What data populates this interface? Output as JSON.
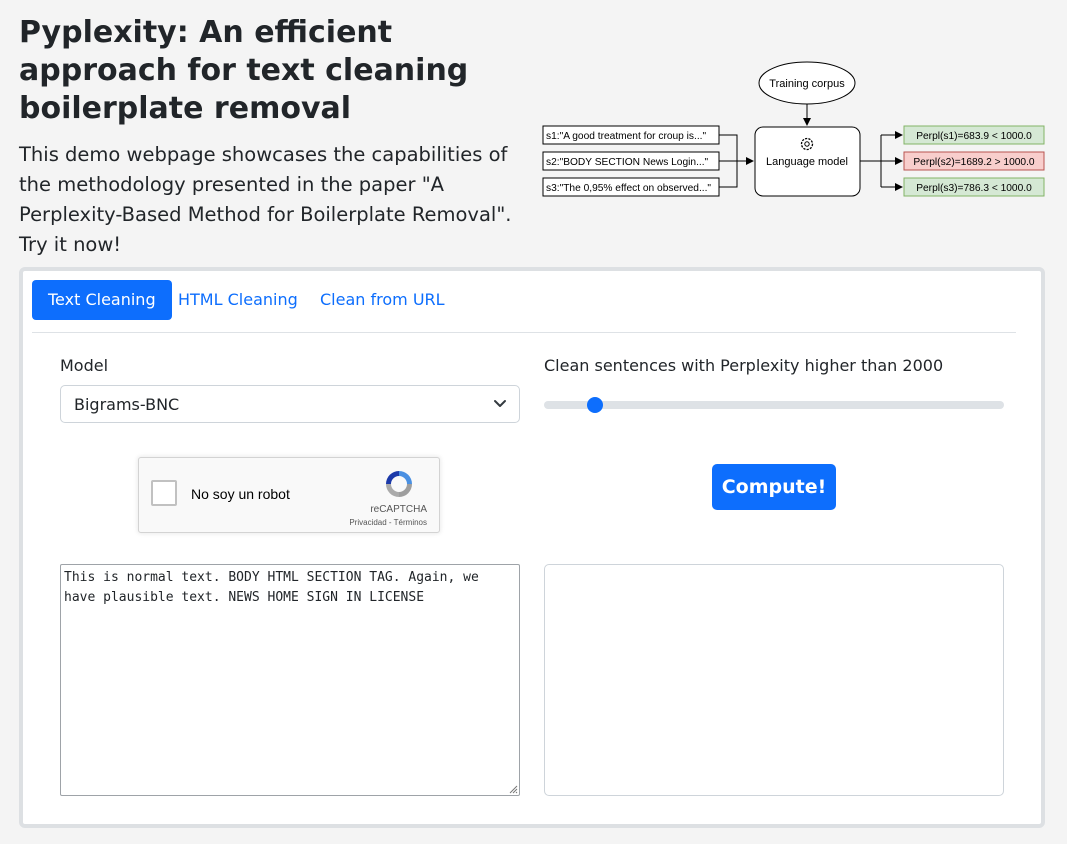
{
  "header": {
    "title": "Pyplexity: An efficient approach for text cleaning boilerplate removal",
    "description": "This demo webpage showcases the capabilities of the methodology presented in the paper \"A Perplexity-Based Method for Boilerplate Removal\". Try it now!"
  },
  "diagram": {
    "training_corpus": "Training corpus",
    "language_model": "Language model",
    "model_icon": "gear-icon",
    "inputs": [
      "s1:\"A good treatment for croup is...\"",
      "s2:\"BODY SECTION News Login...\"",
      "s3:\"The 0,95% effect on observed...\""
    ],
    "outputs": [
      "Perpl(s1)=683.9 < 1000.0",
      "Perpl(s2)=1689.2 > 1000.0",
      "Perpl(s3)=786.3 < 1000.0"
    ],
    "output_colors": [
      "#d5e8d4",
      "#f8cecc",
      "#d5e8d4"
    ]
  },
  "tabs": {
    "items": [
      "Text Cleaning",
      "HTML Cleaning",
      "Clean from URL"
    ],
    "active": "Text Cleaning"
  },
  "form": {
    "model_label": "Model",
    "model_value": "Bigrams-BNC",
    "threshold_label": "Clean sentences with Perplexity higher than 2000",
    "threshold_value": 2000,
    "slider_fraction": 0.11,
    "captcha_label": "No soy un robot",
    "captcha_brand": "reCAPTCHA",
    "captcha_links": "Privacidad - Términos",
    "compute_label": "Compute!",
    "input_text": "This is normal text. BODY HTML SECTION TAG. Again, we have plausible text. NEWS HOME SIGN IN LICENSE",
    "output_text": ""
  },
  "colors": {
    "accent": "#0d6efd",
    "background": "#f4f4f4"
  }
}
